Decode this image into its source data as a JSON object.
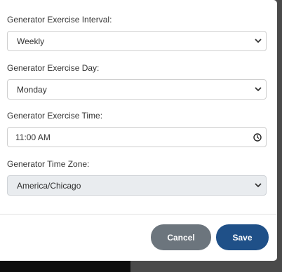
{
  "form": {
    "interval": {
      "label": "Generator Exercise Interval:",
      "value": "Weekly"
    },
    "day": {
      "label": "Generator Exercise Day:",
      "value": "Monday"
    },
    "time": {
      "label": "Generator Exercise Time:",
      "value": "11:00 AM"
    },
    "timezone": {
      "label": "Generator Time Zone:",
      "value": "America/Chicago",
      "disabled": true
    }
  },
  "footer": {
    "cancel_label": "Cancel",
    "save_label": "Save"
  },
  "icons": {
    "select": "chevron-down-icon",
    "time": "clock-icon"
  },
  "colors": {
    "save": "#1f5088",
    "cancel": "#6c757d",
    "disabled_bg": "#e9ecef"
  }
}
